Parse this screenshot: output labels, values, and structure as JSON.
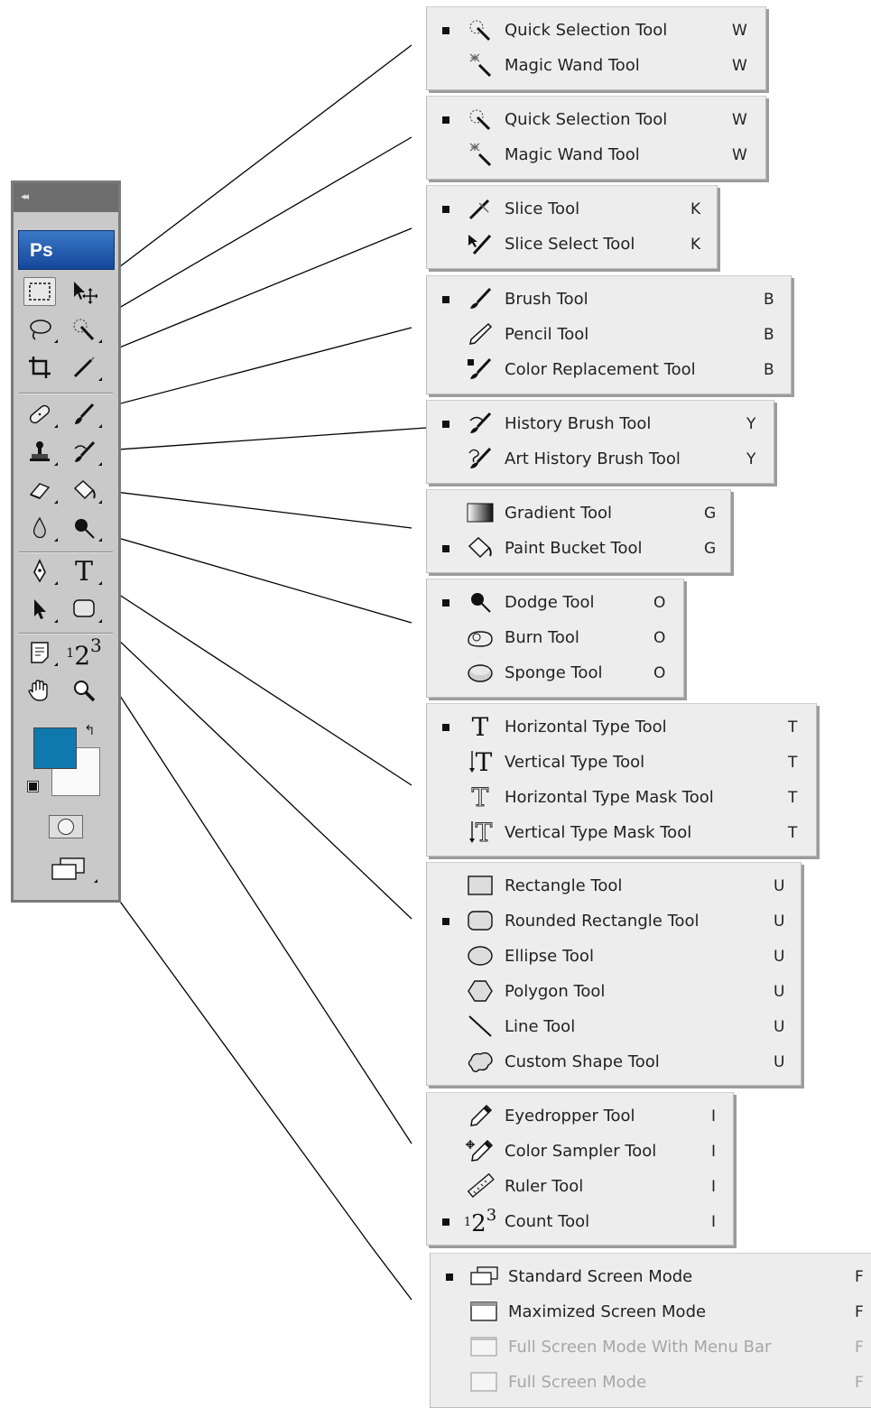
{
  "toolbox": {
    "collapse": "◂◂",
    "logo": "Ps",
    "tools": [
      {
        "name": "rect-marquee",
        "icon": "rect-marquee-icon"
      },
      {
        "name": "move",
        "icon": "move-icon"
      },
      {
        "name": "lasso",
        "icon": "lasso-icon"
      },
      {
        "name": "quick-selection",
        "icon": "quick-selection-icon"
      },
      {
        "name": "crop",
        "icon": "crop-icon"
      },
      {
        "name": "slice",
        "icon": "slice-icon"
      },
      {
        "name": "spot-healing",
        "icon": "bandage-icon"
      },
      {
        "name": "brush",
        "icon": "brush-icon"
      },
      {
        "name": "clone-stamp",
        "icon": "stamp-icon"
      },
      {
        "name": "history-brush",
        "icon": "history-brush-icon"
      },
      {
        "name": "eraser",
        "icon": "eraser-icon"
      },
      {
        "name": "paint-bucket",
        "icon": "paint-bucket-icon"
      },
      {
        "name": "blur",
        "icon": "drop-icon"
      },
      {
        "name": "dodge",
        "icon": "dodge-icon"
      },
      {
        "name": "pen",
        "icon": "pen-icon"
      },
      {
        "name": "type",
        "icon": "type-icon"
      },
      {
        "name": "path-selection",
        "icon": "arrow-icon"
      },
      {
        "name": "shape",
        "icon": "rounded-rect-icon"
      },
      {
        "name": "notes",
        "icon": "notes-icon"
      },
      {
        "name": "count",
        "icon": "count-icon"
      },
      {
        "name": "hand",
        "icon": "hand-icon"
      },
      {
        "name": "zoom",
        "icon": "magnifier-icon"
      }
    ],
    "type_glyph": "T",
    "count_glyph_1": "1",
    "count_glyph_2": "2",
    "count_glyph_3": "3",
    "swap_glyph": "↰",
    "foreground_color": "#0f79ad",
    "background_color": "#fafafa"
  },
  "menus": [
    {
      "items": [
        {
          "label": "Quick Selection Tool",
          "key": "W",
          "selected": true,
          "icon": "quick-selection-icon"
        },
        {
          "label": "Magic Wand Tool",
          "key": "W",
          "selected": false,
          "icon": "magic-wand-icon"
        }
      ]
    },
    {
      "items": [
        {
          "label": "Quick Selection Tool",
          "key": "W",
          "selected": true,
          "icon": "quick-selection-icon"
        },
        {
          "label": "Magic Wand Tool",
          "key": "W",
          "selected": false,
          "icon": "magic-wand-icon"
        }
      ]
    },
    {
      "items": [
        {
          "label": "Slice Tool",
          "key": "K",
          "selected": true,
          "icon": "slice-icon"
        },
        {
          "label": "Slice Select Tool",
          "key": "K",
          "selected": false,
          "icon": "slice-select-icon"
        }
      ]
    },
    {
      "items": [
        {
          "label": "Brush Tool",
          "key": "B",
          "selected": true,
          "icon": "brush-icon"
        },
        {
          "label": "Pencil Tool",
          "key": "B",
          "selected": false,
          "icon": "pencil-icon"
        },
        {
          "label": "Color Replacement Tool",
          "key": "B",
          "selected": false,
          "icon": "color-replacement-icon"
        }
      ]
    },
    {
      "items": [
        {
          "label": "History Brush Tool",
          "key": "Y",
          "selected": true,
          "icon": "history-brush-icon"
        },
        {
          "label": "Art History Brush Tool",
          "key": "Y",
          "selected": false,
          "icon": "art-history-brush-icon"
        }
      ]
    },
    {
      "items": [
        {
          "label": "Gradient Tool",
          "key": "G",
          "selected": false,
          "icon": "gradient-icon"
        },
        {
          "label": "Paint Bucket Tool",
          "key": "G",
          "selected": true,
          "icon": "paint-bucket-icon"
        }
      ]
    },
    {
      "items": [
        {
          "label": "Dodge Tool",
          "key": "O",
          "selected": true,
          "icon": "dodge-icon"
        },
        {
          "label": "Burn Tool",
          "key": "O",
          "selected": false,
          "icon": "burn-icon"
        },
        {
          "label": "Sponge Tool",
          "key": "O",
          "selected": false,
          "icon": "sponge-icon"
        }
      ]
    },
    {
      "items": [
        {
          "label": "Horizontal Type Tool",
          "key": "T",
          "selected": true,
          "icon": "horizontal-type-icon"
        },
        {
          "label": "Vertical Type Tool",
          "key": "T",
          "selected": false,
          "icon": "vertical-type-icon"
        },
        {
          "label": "Horizontal Type Mask Tool",
          "key": "T",
          "selected": false,
          "icon": "horizontal-type-mask-icon"
        },
        {
          "label": "Vertical Type Mask Tool",
          "key": "T",
          "selected": false,
          "icon": "vertical-type-mask-icon"
        }
      ]
    },
    {
      "items": [
        {
          "label": "Rectangle Tool",
          "key": "U",
          "selected": false,
          "icon": "rectangle-icon"
        },
        {
          "label": "Rounded Rectangle Tool",
          "key": "U",
          "selected": true,
          "icon": "rounded-rectangle-icon"
        },
        {
          "label": "Ellipse Tool",
          "key": "U",
          "selected": false,
          "icon": "ellipse-icon"
        },
        {
          "label": "Polygon Tool",
          "key": "U",
          "selected": false,
          "icon": "polygon-icon"
        },
        {
          "label": "Line Tool",
          "key": "U",
          "selected": false,
          "icon": "line-icon"
        },
        {
          "label": "Custom Shape Tool",
          "key": "U",
          "selected": false,
          "icon": "custom-shape-icon"
        }
      ]
    },
    {
      "items": [
        {
          "label": "Eyedropper Tool",
          "key": "I",
          "selected": false,
          "icon": "eyedropper-icon"
        },
        {
          "label": "Color Sampler Tool",
          "key": "I",
          "selected": false,
          "icon": "color-sampler-icon"
        },
        {
          "label": "Ruler Tool",
          "key": "I",
          "selected": false,
          "icon": "ruler-icon"
        },
        {
          "label": "Count Tool",
          "key": "I",
          "selected": true,
          "icon": "count-icon"
        }
      ]
    },
    {
      "items": [
        {
          "label": "Standard Screen Mode",
          "key": "F",
          "selected": true,
          "icon": "standard-screen-icon"
        },
        {
          "label": "Maximized Screen Mode",
          "key": "F",
          "selected": false,
          "icon": "maximized-screen-icon"
        },
        {
          "label": "Full Screen Mode With Menu Bar",
          "key": "F",
          "selected": false,
          "disabled": true,
          "icon": "full-screen-menu-icon"
        },
        {
          "label": "Full Screen Mode",
          "key": "F",
          "selected": false,
          "disabled": true,
          "icon": "full-screen-icon"
        }
      ]
    }
  ]
}
